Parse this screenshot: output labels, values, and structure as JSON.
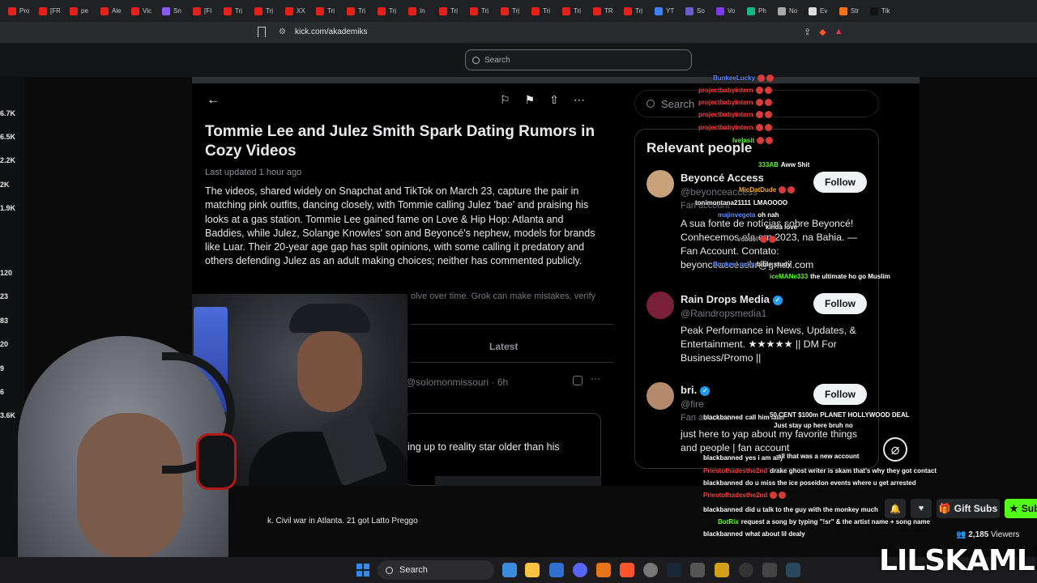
{
  "browser": {
    "tabs": [
      {
        "label": "Pro",
        "color": "#e62117"
      },
      {
        "label": "[FR",
        "color": "#e62117"
      },
      {
        "label": "pe",
        "color": "#e62117"
      },
      {
        "label": "Ale",
        "color": "#e62117"
      },
      {
        "label": "Vic",
        "color": "#e62117"
      },
      {
        "label": "Sn",
        "color": "#8b5cf6"
      },
      {
        "label": "[FI",
        "color": "#e62117"
      },
      {
        "label": "Trị",
        "color": "#e62117"
      },
      {
        "label": "Trị",
        "color": "#e62117"
      },
      {
        "label": "XX",
        "color": "#e62117"
      },
      {
        "label": "Trị",
        "color": "#e62117"
      },
      {
        "label": "Trị",
        "color": "#e62117"
      },
      {
        "label": "Trị",
        "color": "#e62117"
      },
      {
        "label": "In",
        "color": "#e62117"
      },
      {
        "label": "Trị",
        "color": "#e62117"
      },
      {
        "label": "Trị",
        "color": "#e62117"
      },
      {
        "label": "Trị",
        "color": "#e62117"
      },
      {
        "label": "Trị",
        "color": "#e62117"
      },
      {
        "label": "Trị",
        "color": "#e62117"
      },
      {
        "label": "TR",
        "color": "#e62117"
      },
      {
        "label": "Trị",
        "color": "#e62117"
      },
      {
        "label": "YT",
        "color": "#3b82f6"
      },
      {
        "label": "So",
        "color": "#6d5bd0"
      },
      {
        "label": "Vo",
        "color": "#7c3aed"
      },
      {
        "label": "Ph",
        "color": "#10b981"
      },
      {
        "label": "No",
        "color": "#aaaaaa"
      },
      {
        "label": "Ev",
        "color": "#dddddd"
      },
      {
        "label": "Str",
        "color": "#f97316"
      },
      {
        "label": "Tik",
        "color": "#111111"
      }
    ],
    "url": "kick.com/akademiks"
  },
  "kick": {
    "search_placeholder": "Search",
    "sidebar_counts": [
      "6.7K",
      "6.5K",
      "2.2K",
      "2K",
      "1.9K",
      "120",
      "23",
      "83",
      "20",
      "9",
      "6",
      "3.6K"
    ],
    "ticker": "k. Civil war in Atlanta. 21 got Latto Preggo",
    "viewers_count": "2,185",
    "viewers_label": "Viewers",
    "gift_label": "Gift Subs",
    "sub_label": "Sub",
    "watermark": "LILSKAMLIVE",
    "accent": "#53fc18"
  },
  "x_post": {
    "title": "Tommie Lee and Julez Smith Spark Dating Rumors in Cozy Videos",
    "updated": "Last updated 1 hour ago",
    "body": "The videos, shared widely on Snapchat and TikTok on March 23, capture the pair in matching pink outfits, dancing closely, with Tommie calling Julez 'bae' and praising his looks at a gas station. Tommie Lee gained fame on Love & Hip Hop: Atlanta and Baddies, while Julez, Solange Knowles' son and Beyoncé's nephew, models for brands like Luar. Their 20-year age gap has split opinions, with some calling it predatory and others defending Julez as an adult making choices; neither has commented publicly.",
    "disclaimer": "olve over time. Grok can make mistakes, verify",
    "tab_latest": "Latest",
    "post_user": "@solomonmissouri · 6h",
    "post_snippet": "ing up to reality star older than his",
    "search_placeholder": "Search",
    "relevant_title": "Relevant people",
    "people": [
      {
        "name": "Beyoncé Access",
        "handle": "@beyonceaccess",
        "sub": "Fan account",
        "bio": "A sua fonte de notícias sobre Beyoncé! Conhecemos ela em 2023, na Bahia. — Fan Account. Contato: beyonceaccessbr@gmail.com",
        "follow": "Follow",
        "verified": false,
        "avatar_color": "#c7a27a"
      },
      {
        "name": "Rain Drops Media",
        "handle": "@Raindropsmedia1",
        "sub": "",
        "bio": "Peak Performance in News, Updates, & Entertainment. ★★★★★ || DM For Business/Promo ||",
        "follow": "Follow",
        "verified": true,
        "avatar_color": "#7a1f3a"
      },
      {
        "name": "bri.",
        "handle": "@fire",
        "sub": "Fan account",
        "bio": "just here to yap about my favorite things and people | fan account",
        "follow": "Follow",
        "verified": true,
        "avatar_color": "#b58a6a"
      }
    ]
  },
  "chat": [
    {
      "user": "BunkeeLucky",
      "msg": "",
      "color": "#5b8cff"
    },
    {
      "user": "projectbabyintern",
      "msg": "",
      "color": "#ff3b3b"
    },
    {
      "user": "projectbabyintern",
      "msg": "",
      "color": "#ff3b3b"
    },
    {
      "user": "projectbabyintern",
      "msg": "",
      "color": "#ff3b3b"
    },
    {
      "user": "projectbabyintern",
      "msg": "",
      "color": "#ff3b3b"
    },
    {
      "user": "lvelasit",
      "msg": "",
      "color": "#53fc18"
    },
    {
      "user": "333AB",
      "msg": "Aww Shit",
      "color": "#53fc18"
    },
    {
      "user": "MicDatDude",
      "msg": "",
      "color": "#f5a623"
    },
    {
      "user": "tonimontana21111",
      "msg": "LMAOOOO",
      "color": "#ffffff"
    },
    {
      "user": "majinvegeta",
      "msg": "oh nah",
      "color": "#5b8cff"
    },
    {
      "user": "",
      "msg": "kinda love",
      "color": "#ffffff"
    },
    {
      "user": "vcodel",
      "msg": "",
      "color": "#aaaaaa"
    },
    {
      "user": "Buckeel ucky",
      "msg": "bible study",
      "color": "#5b8cff"
    },
    {
      "user": "iceMANe333",
      "msg": "the ultimate ho go Muslim",
      "color": "#53fc18"
    },
    {
      "user": "blackbanned",
      "msg": "call him later",
      "color": "#ffffff"
    },
    {
      "user": "",
      "msg": "50 CENT $100m PLANET HOLLYWOOD DEAL",
      "color": "#ffffff"
    },
    {
      "user": "",
      "msg": "Just stay up here bruh no",
      "color": "#ffffff"
    },
    {
      "user": "blackbanned",
      "msg": "yes i am ally",
      "color": "#ffffff"
    },
    {
      "user": "",
      "msg": "all that was a new account",
      "color": "#ffffff"
    },
    {
      "user": "Priestofhadesthe2nd",
      "msg": "drake ghost writer is skam that's why they got contact",
      "color": "#ff3b3b"
    },
    {
      "user": "blackbanned",
      "msg": "do u miss the ice poseidon events where u get arrested",
      "color": "#ffffff"
    },
    {
      "user": "Priestofhadesthe2nd",
      "msg": "",
      "color": "#ff3b3b"
    },
    {
      "user": "blackbanned",
      "msg": "did u talk to the guy with the monkey much",
      "color": "#ffffff"
    },
    {
      "user": "BotRix",
      "msg": "request a song by typing \"!sr\" & the artist name + song name",
      "color": "#53fc18"
    },
    {
      "user": "blackbanned",
      "msg": "what about lil dealy",
      "color": "#ffffff"
    }
  ],
  "taskbar": {
    "search_label": "Search"
  }
}
